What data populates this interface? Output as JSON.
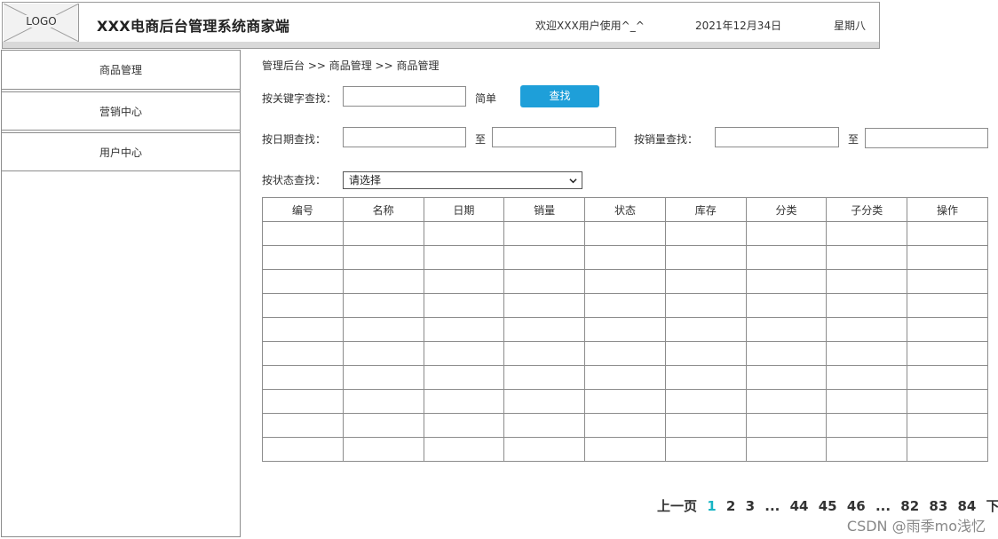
{
  "header": {
    "logo": "LOGO",
    "title": "XXX电商后台管理系统商家端",
    "welcome": "欢迎XXX用户使用^_^",
    "date": "2021年12月34日",
    "weekday": "星期八"
  },
  "sidebar": {
    "items": [
      {
        "label": "商品管理"
      },
      {
        "label": "营销中心"
      },
      {
        "label": "用户中心"
      }
    ]
  },
  "breadcrumb": "管理后台 >> 商品管理 >> 商品管理",
  "filters": {
    "keyword_label": "按关键字查找：",
    "keyword_value": "",
    "simple_label": "简单",
    "search_button": "查找",
    "date_label": "按日期查找：",
    "to_label": "至",
    "sales_label": "按销量查找：",
    "sales_to_label": "至",
    "status_label": "按状态查找：",
    "status_selected": "请选择"
  },
  "table": {
    "headers": [
      "编号",
      "名称",
      "日期",
      "销量",
      "状态",
      "库存",
      "分类",
      "子分类",
      "操作"
    ],
    "row_count": 10
  },
  "pagination": {
    "prev": "上一页",
    "pages": [
      "1",
      "2",
      "3",
      "...",
      "44",
      "45",
      "46",
      "...",
      "82",
      "83",
      "84"
    ],
    "current": "1",
    "next": "下一页"
  },
  "watermark": "CSDN @雨季mo浅忆",
  "colors": {
    "accent": "#1e9fd9",
    "current_page": "#18b5c4"
  }
}
